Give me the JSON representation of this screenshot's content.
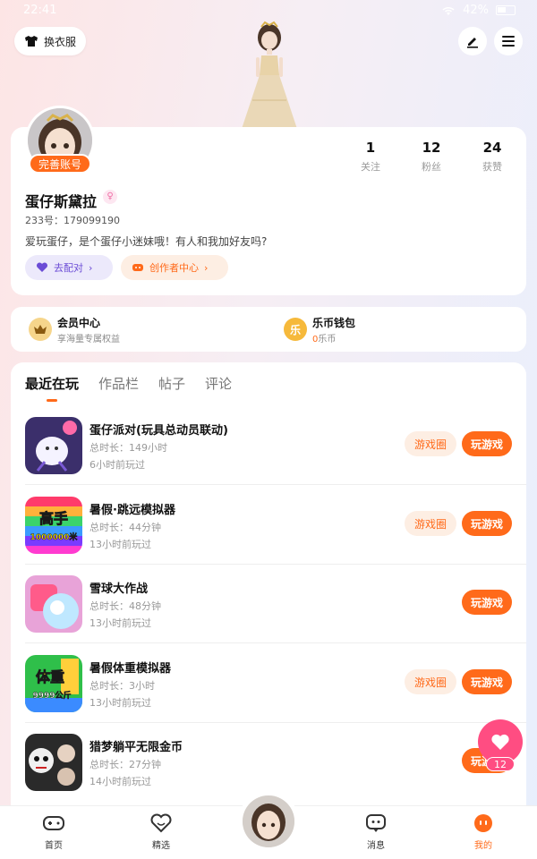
{
  "status": {
    "time": "22:41",
    "battery": "42%"
  },
  "header": {
    "outfit_label": "换衣服"
  },
  "profile": {
    "complete_badge": "完善账号",
    "stats": [
      {
        "num": "1",
        "label": "关注"
      },
      {
        "num": "12",
        "label": "粉丝"
      },
      {
        "num": "24",
        "label": "获赞"
      }
    ],
    "username": "蛋仔斯黛拉",
    "uid": "233号：179099190",
    "bio": "爱玩蛋仔，是个蛋仔小迷妹哦！有人和我加好友吗?",
    "match_label": "去配对",
    "creator_label": "创作者中心"
  },
  "wallet": {
    "vip_title": "会员中心",
    "vip_sub": "享海量专属权益",
    "coin_title": "乐币钱包",
    "coin_value": "0",
    "coin_unit": "乐币",
    "coin_icon": "乐"
  },
  "tabs": [
    "最近在玩",
    "作品栏",
    "帖子",
    "评论"
  ],
  "games": [
    {
      "name": "蛋仔派对(玩具总动员联动)",
      "duration": "总时长：149小时",
      "last": "6小时前玩过",
      "circle": "游戏圈",
      "play": "玩游戏"
    },
    {
      "name": "暑假·跳远模拟器",
      "duration": "总时长：44分钟",
      "last": "13小时前玩过",
      "circle": "游戏圈",
      "play": "玩游戏",
      "icon_text": "高手",
      "icon_sub": "1000000米"
    },
    {
      "name": "雪球大作战",
      "duration": "总时长：48分钟",
      "last": "13小时前玩过",
      "play": "玩游戏"
    },
    {
      "name": "暑假体重模拟器",
      "duration": "总时长：3小时",
      "last": "13小时前玩过",
      "circle": "游戏圈",
      "play": "玩游戏",
      "icon_text": "体重",
      "icon_sub": "9999公斤"
    },
    {
      "name": "猎梦躺平无限金币",
      "duration": "总时长：27分钟",
      "last": "14小时前玩过",
      "play": "玩游戏"
    }
  ],
  "fab": {
    "count": "12"
  },
  "tabbar": [
    {
      "label": "首页"
    },
    {
      "label": "精选"
    },
    {
      "label": "消息"
    },
    {
      "label": "我的"
    }
  ],
  "colors": {
    "accent": "#ff6a1a",
    "heart": "#ff4d82",
    "match": "#6b4cd6"
  }
}
